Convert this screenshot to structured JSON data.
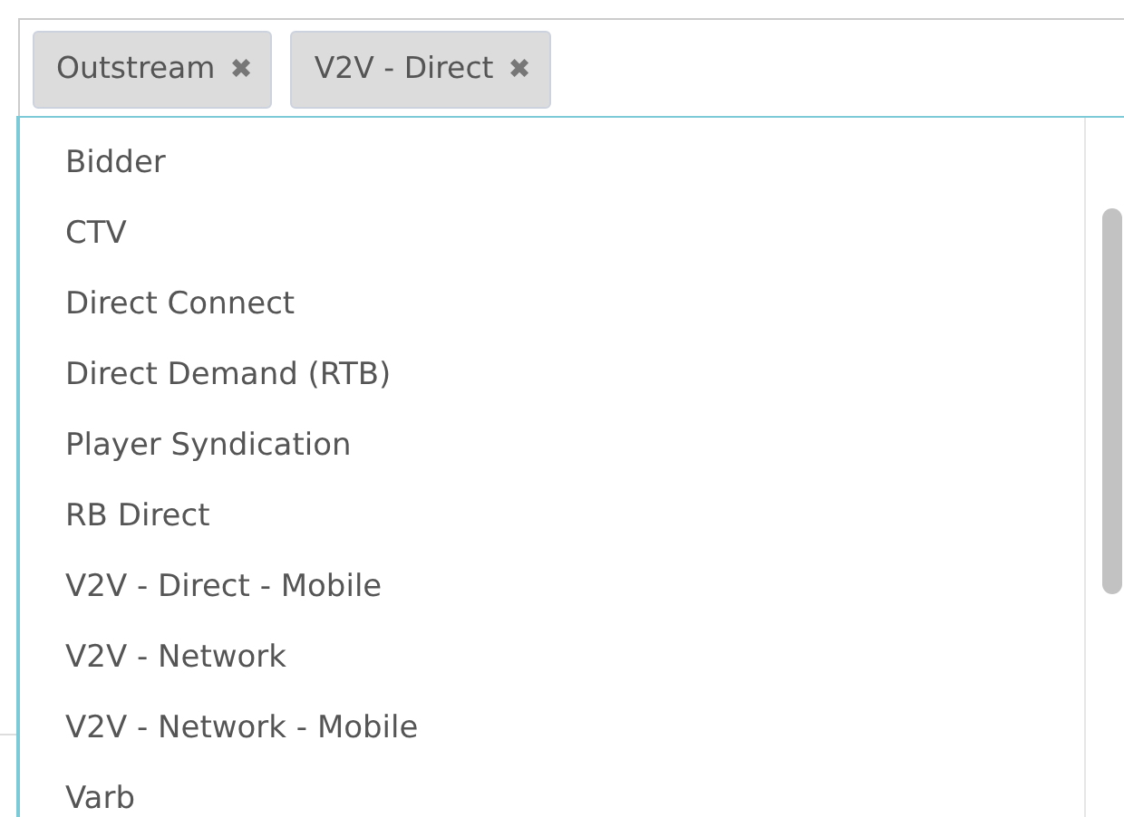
{
  "selected_tags": [
    {
      "label": "Outstream",
      "remove": "✖"
    },
    {
      "label": "V2V - Direct",
      "remove": "✖"
    }
  ],
  "options": [
    {
      "label": "Bidder"
    },
    {
      "label": "CTV"
    },
    {
      "label": "Direct Connect"
    },
    {
      "label": "Direct Demand (RTB)"
    },
    {
      "label": "Player Syndication"
    },
    {
      "label": "RB Direct"
    },
    {
      "label": "V2V - Direct - Mobile"
    },
    {
      "label": "V2V - Network"
    },
    {
      "label": "V2V - Network - Mobile"
    },
    {
      "label": "Varb"
    }
  ]
}
